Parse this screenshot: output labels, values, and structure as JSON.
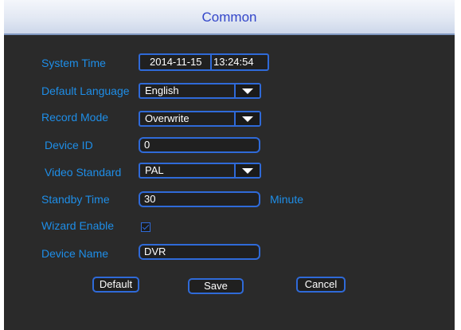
{
  "window": {
    "title": "Common"
  },
  "form": {
    "system_time": {
      "label": "System Time",
      "date": "2014-11-15",
      "time": "13:24:54"
    },
    "default_language": {
      "label": "Default Language",
      "value": "English"
    },
    "record_mode": {
      "label": "Record Mode",
      "value": "Overwrite"
    },
    "device_id": {
      "label": "Device ID",
      "value": "0"
    },
    "video_standard": {
      "label": "Video Standard",
      "value": "PAL"
    },
    "standby_time": {
      "label": "Standby Time",
      "value": "30",
      "unit": "Minute"
    },
    "wizard_enable": {
      "label": "Wizard Enable",
      "checked": true
    },
    "device_name": {
      "label": "Device Name",
      "value": "DVR"
    }
  },
  "buttons": {
    "default": "Default",
    "save": "Save",
    "cancel": "Cancel"
  },
  "colors": {
    "accent": "#2f6ad8",
    "label": "#1e8ee8",
    "title": "#3346c9",
    "background": "#2a2a2a"
  }
}
